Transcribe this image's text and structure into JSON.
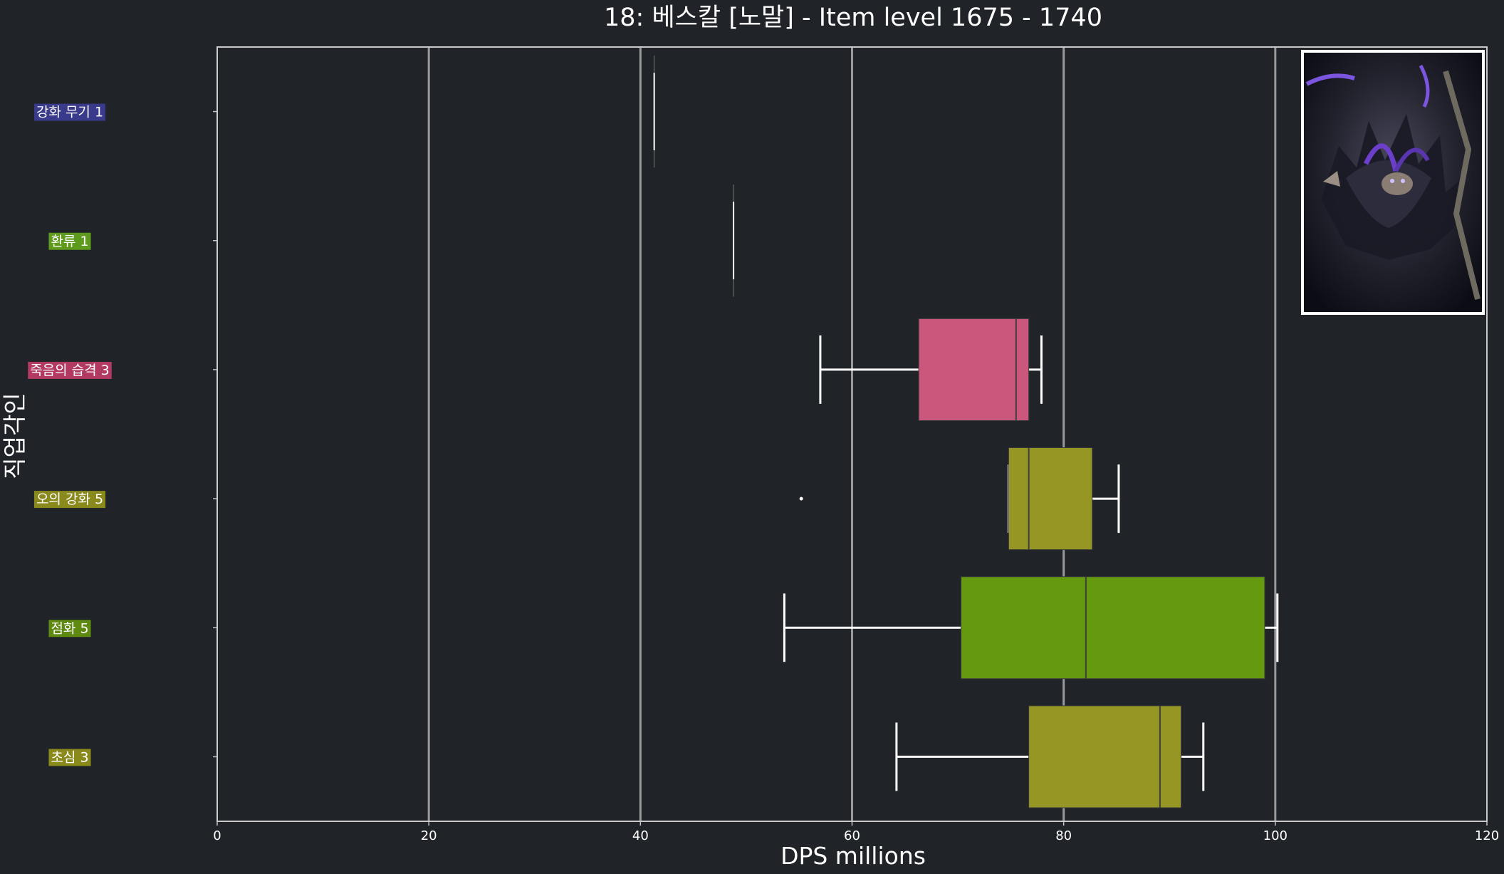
{
  "chart_data": {
    "type": "box",
    "orientation": "horizontal",
    "title": "18: 베스칼 [노말] - Item level 1675 - 1740",
    "xlabel": "DPS millions",
    "ylabel": "직업각인",
    "xlim": [
      0,
      120
    ],
    "xticks": [
      0,
      20,
      40,
      60,
      80,
      100,
      120
    ],
    "grid": "vertical",
    "background": "#202328",
    "inset_image": "boss-portrait",
    "categories": [
      {
        "label": "강화 무기 1",
        "label_color": "#3a3a8c",
        "color": "#3a3a8c",
        "min": 41.3,
        "q1": 41.3,
        "median": 41.3,
        "q3": 41.3,
        "max": 41.3,
        "outliers": []
      },
      {
        "label": "환류 1",
        "label_color": "#5e9a1c",
        "color": "#5e9a1c",
        "min": 48.8,
        "q1": 48.8,
        "median": 48.8,
        "q3": 48.8,
        "max": 48.8,
        "outliers": []
      },
      {
        "label": "죽음의 습격 3",
        "label_color": "#b23a62",
        "color": "#cc577c",
        "min": 57.0,
        "q1": 66.3,
        "median": 75.5,
        "q3": 76.7,
        "max": 77.9,
        "outliers": []
      },
      {
        "label": "오의 강화 5",
        "label_color": "#8a8a1c",
        "color": "#969625",
        "min": 74.8,
        "q1": 74.8,
        "median": 76.7,
        "q3": 82.7,
        "max": 85.2,
        "outliers": [
          55.2
        ]
      },
      {
        "label": "점화 5",
        "label_color": "#5e8a10",
        "color": "#65990f",
        "min": 53.6,
        "q1": 70.3,
        "median": 82.1,
        "q3": 99.0,
        "max": 100.2,
        "outliers": []
      },
      {
        "label": "초심 3",
        "label_color": "#8a8a1c",
        "color": "#969625",
        "min": 64.2,
        "q1": 76.7,
        "median": 89.1,
        "q3": 91.1,
        "max": 93.2,
        "outliers": []
      }
    ]
  }
}
